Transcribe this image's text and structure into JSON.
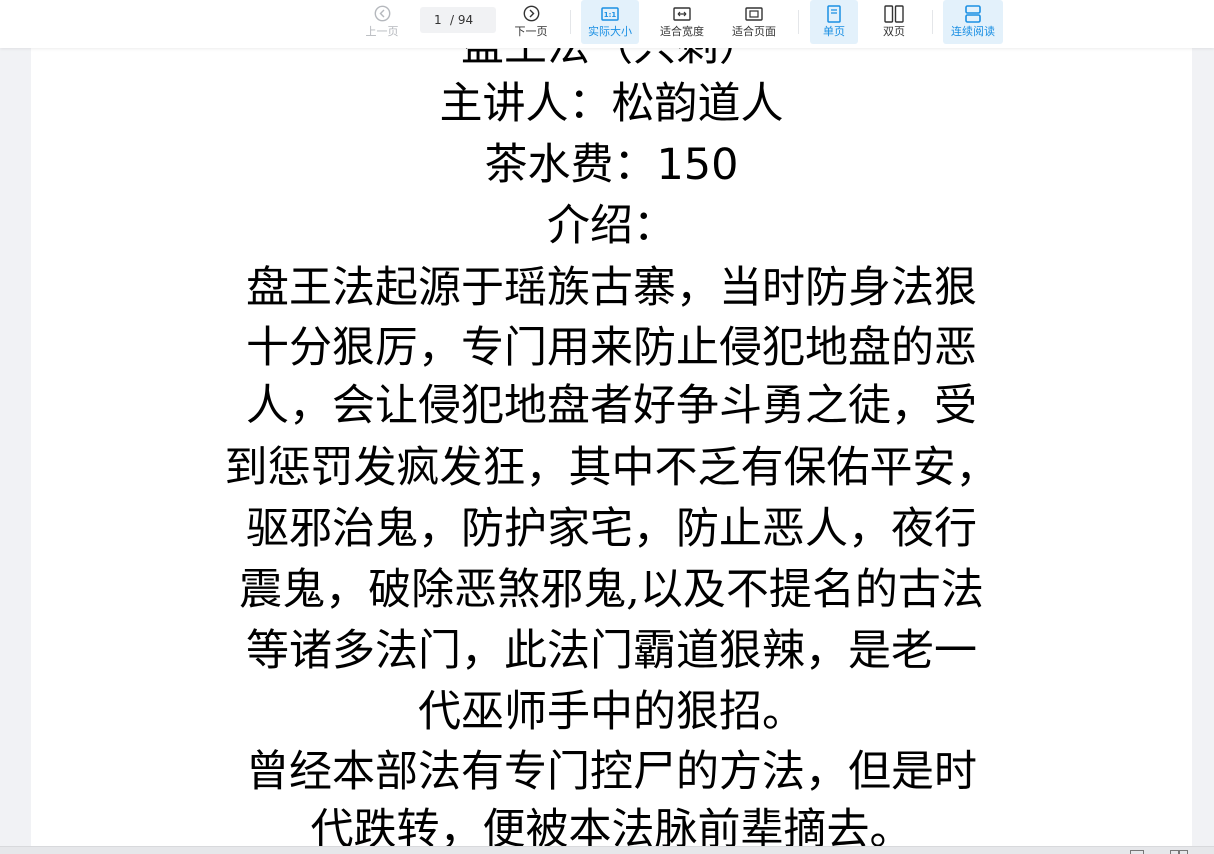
{
  "toolbar": {
    "prev_label": "上一页",
    "page_current": "1",
    "page_total": "/ 94",
    "next_label": "下一页",
    "actual_size_label": "实际大小",
    "fit_width_label": "适合宽度",
    "fit_page_label": "适合页面",
    "single_page_label": "单页",
    "double_page_label": "双页",
    "continuous_label": "连续阅读",
    "accent_color": "#1a8fe3",
    "active_bg": "#e3f1fb"
  },
  "document": {
    "lines": [
      "盘王法（只剩）",
      "主讲人：松韵道人",
      "茶水费：150",
      "介绍：",
      "盘王法起源于瑶族古寨，当时防身法狠",
      "十分狠厉，专门用来防止侵犯地盘的恶",
      "人，会让侵犯地盘者好争斗勇之徒，受",
      "到惩罚发疯发狂，其中不乏有保佑平安，",
      "驱邪治鬼，防护家宅，防止恶人，夜行",
      "震鬼，破除恶煞邪鬼,以及不提名的古法",
      "等诸多法门，此法门霸道狠辣，是老一",
      "代巫师手中的狠招。",
      "曾经本部法有专门控尸的方法，但是时",
      "代跌转，便被本法脉前辈摘去。"
    ]
  }
}
